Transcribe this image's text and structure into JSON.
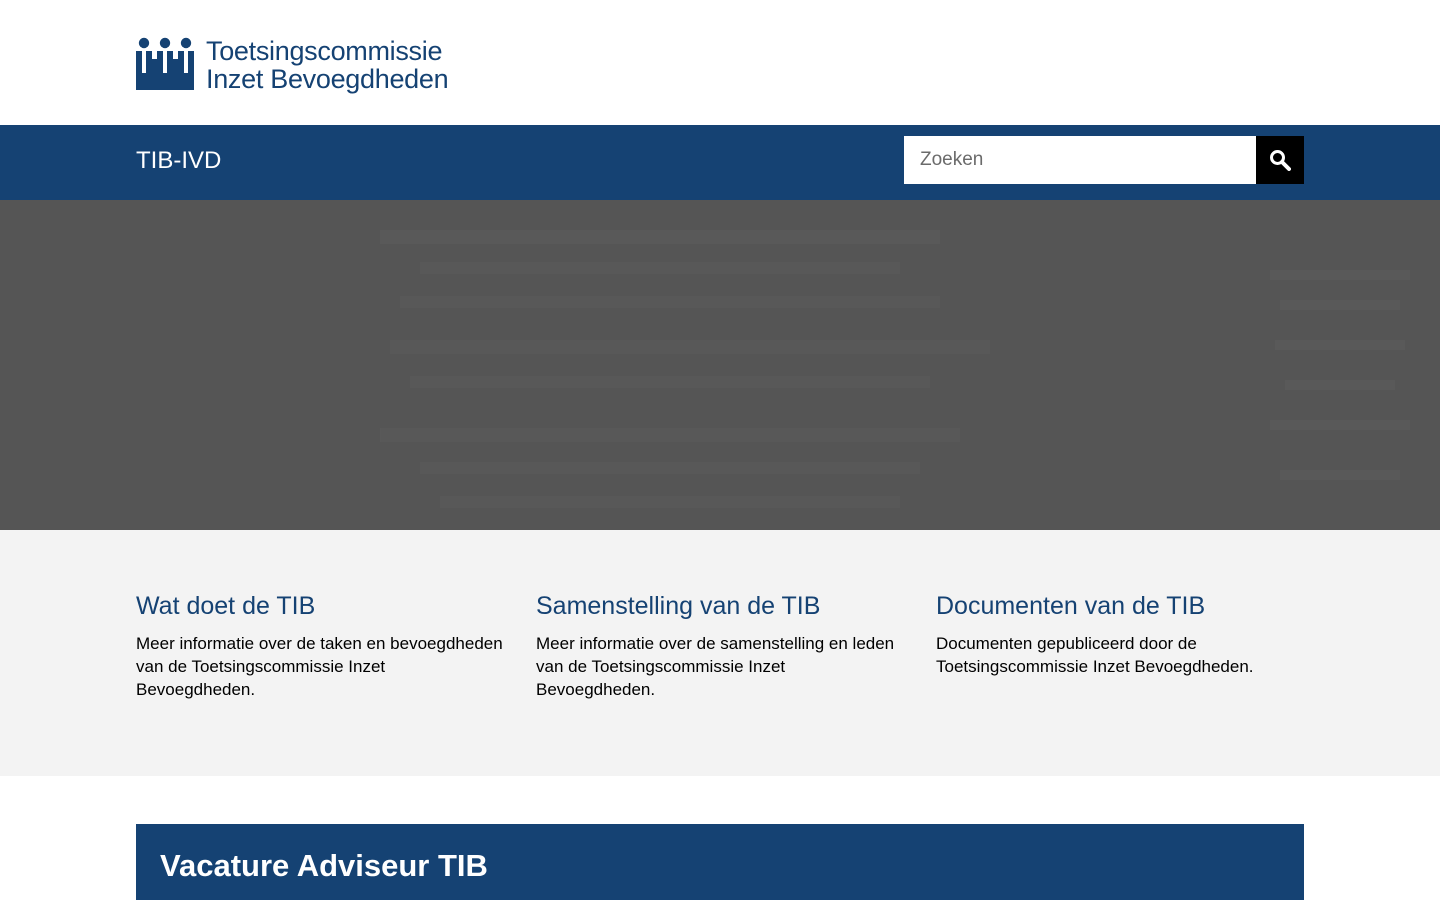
{
  "header": {
    "logo_line1": "Toetsingscommissie",
    "logo_line2": "Inzet Bevoegdheden",
    "logo_icon": "ministry-figures-logo"
  },
  "nav": {
    "site_name": "TIB-IVD",
    "search_placeholder": "Zoeken",
    "search_icon": "search-icon"
  },
  "cards": [
    {
      "title": "Wat doet de TIB",
      "text": "Meer informatie over de taken en bevoegdheden van de Toetsingscommissie Inzet Bevoegdheden."
    },
    {
      "title": "Samenstelling van de TIB",
      "text": "Meer informatie over de samenstelling en leden van de Toetsingscommissie Inzet Bevoegdheden."
    },
    {
      "title": "Documenten van de TIB",
      "text": "Documenten gepubliceerd door de Toetsingscommissie Inzet Bevoegdheden."
    }
  ],
  "vacancy": {
    "title": "Vacature Adviseur TIB"
  },
  "colors": {
    "brand_blue": "#154273",
    "hero_gray": "#555555",
    "section_gray": "#f3f3f3",
    "search_button": "#000000"
  }
}
